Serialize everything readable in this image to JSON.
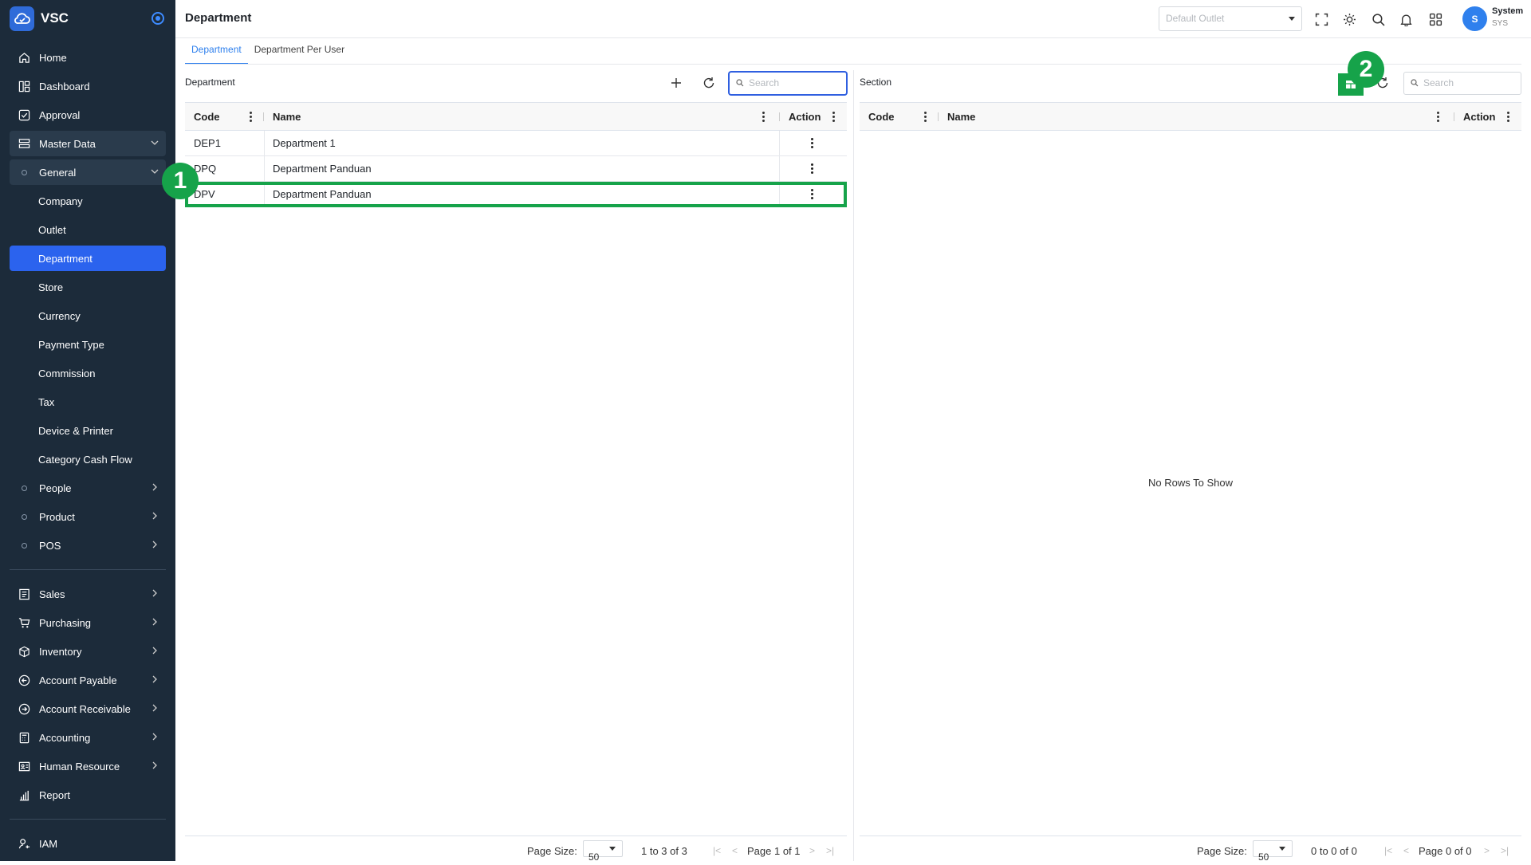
{
  "app": {
    "name": "VSC"
  },
  "sidebar": {
    "top": [
      {
        "label": "Home",
        "icon": "home-icon"
      },
      {
        "label": "Dashboard",
        "icon": "dashboard-icon"
      },
      {
        "label": "Approval",
        "icon": "approval-icon"
      },
      {
        "label": "Master Data",
        "icon": "master-data-icon"
      }
    ],
    "general": "General",
    "general_items": [
      "Company",
      "Outlet",
      "Department",
      "Store",
      "Currency",
      "Payment Type",
      "Commission",
      "Tax",
      "Device & Printer",
      "Category Cash Flow"
    ],
    "groups": [
      "People",
      "Product",
      "POS"
    ],
    "modules": [
      {
        "label": "Sales",
        "icon": "sales-icon"
      },
      {
        "label": "Purchasing",
        "icon": "cart-icon"
      },
      {
        "label": "Inventory",
        "icon": "box-icon"
      },
      {
        "label": "Account Payable",
        "icon": "arrow-left-circle-icon"
      },
      {
        "label": "Account Receivable",
        "icon": "arrow-right-circle-icon"
      },
      {
        "label": "Accounting",
        "icon": "calculator-icon"
      },
      {
        "label": "Human Resource",
        "icon": "id-card-icon"
      },
      {
        "label": "Report",
        "icon": "bar-chart-icon"
      }
    ],
    "iam": "IAM"
  },
  "header": {
    "title": "Department",
    "outlet_placeholder": "Default Outlet",
    "user_name": "System",
    "user_role": "SYS",
    "avatar_initial": "S"
  },
  "tabs": [
    "Department",
    "Department Per User"
  ],
  "department": {
    "title": "Department",
    "search_placeholder": "Search",
    "columns": [
      "Code",
      "Name",
      "Action"
    ],
    "rows": [
      {
        "code": "DEP1",
        "name": "Department 1"
      },
      {
        "code": "DPQ",
        "name": "Department Panduan"
      },
      {
        "code": "DPV",
        "name": "Department Panduan"
      }
    ],
    "footer": {
      "page_size_label": "Page Size:",
      "page_size": "50",
      "range": "1 to 3 of 3",
      "page": "Page 1 of 1"
    }
  },
  "section": {
    "title": "Section",
    "search_placeholder": "Search",
    "columns": [
      "Code",
      "Name",
      "Action"
    ],
    "empty": "No Rows To Show",
    "footer": {
      "page_size_label": "Page Size:",
      "page_size": "50",
      "range": "0 to 0 of 0",
      "page": "Page 0 of 0"
    }
  },
  "annotations": {
    "step1": "1",
    "step2": "2",
    "color": "#16a34a"
  }
}
